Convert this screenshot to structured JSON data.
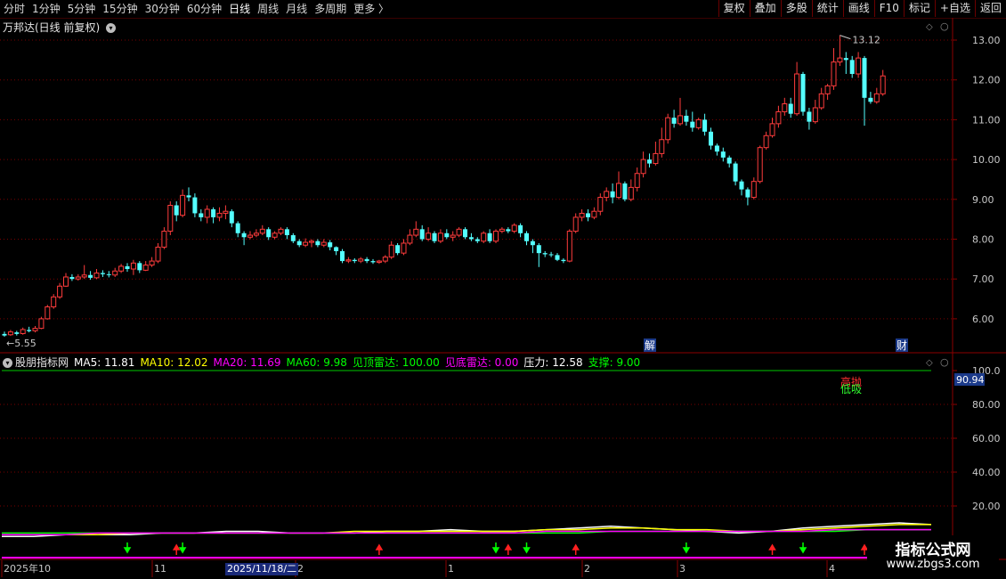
{
  "toolbar": {
    "periods": [
      "分时",
      "1分钟",
      "5分钟",
      "15分钟",
      "30分钟",
      "60分钟",
      "日线",
      "周线",
      "月线",
      "多周期",
      "更多 〉"
    ],
    "active_period": "日线",
    "right_buttons": [
      "复权",
      "叠加",
      "多股",
      "统计",
      "画线",
      "F10",
      "标记",
      "+自选",
      "返回"
    ]
  },
  "stock": {
    "title": "万邦达(日线 前复权)",
    "high_marker": "13.12",
    "low_marker": "5.55",
    "event_labels": [
      "解",
      "财"
    ]
  },
  "price_axis": {
    "ticks": [
      "13.00",
      "12.00",
      "11.00",
      "10.00",
      "9.00",
      "8.00",
      "7.00",
      "6.00"
    ]
  },
  "indicator": {
    "name": "股朋指标网",
    "ma5_label": "MA5: 11.81",
    "ma10_label": "MA10: 12.02",
    "ma20_label": "MA20: 11.69",
    "ma60_label": "MA60: 9.98",
    "top_radar_label": "见顶雷达: 100.00",
    "bottom_radar_label": "见底雷达: 0.00",
    "pressure_label": "压力: 12.58",
    "support_label": "支撑: 9.00",
    "tag_high": "高抛",
    "tag_low": "低吸",
    "current_value": "90.94",
    "axis_ticks": [
      "100.0",
      "80.00",
      "60.00",
      "40.00",
      "20.00"
    ]
  },
  "date_axis": {
    "labels": [
      "2025年10",
      "11",
      "2",
      "1",
      "2",
      "3",
      "4"
    ],
    "highlighted": "2025/11/18/二"
  },
  "watermark": {
    "title": "指标公式网",
    "url": "www.zbgs3.com"
  },
  "colors": {
    "up": "#ff3c3c",
    "down": "#54ffff",
    "ma5": "#ffffff",
    "ma10": "#ffff00",
    "ma20": "#ff00ff",
    "ma60": "#00ff00",
    "grid": "#7a0000"
  },
  "chart_data": {
    "type": "candlestick",
    "series": [
      {
        "name": "K线",
        "values": [
          [
            5.62,
            5.58,
            5.68,
            5.55
          ],
          [
            5.6,
            5.67,
            5.72,
            5.57
          ],
          [
            5.66,
            5.62,
            5.7,
            5.58
          ],
          [
            5.63,
            5.73,
            5.78,
            5.6
          ],
          [
            5.72,
            5.69,
            5.8,
            5.66
          ],
          [
            5.7,
            5.76,
            5.82,
            5.66
          ],
          [
            5.76,
            6.0,
            6.05,
            5.74
          ],
          [
            6.0,
            6.3,
            6.35,
            5.98
          ],
          [
            6.3,
            6.55,
            6.62,
            6.25
          ],
          [
            6.55,
            6.82,
            6.9,
            6.5
          ],
          [
            6.82,
            7.05,
            7.15,
            6.8
          ],
          [
            7.05,
            7.0,
            7.12,
            6.95
          ],
          [
            7.0,
            7.05,
            7.12,
            6.96
          ],
          [
            7.05,
            7.1,
            7.35,
            7.0
          ],
          [
            7.1,
            7.03,
            7.2,
            6.98
          ],
          [
            7.03,
            7.15,
            7.25,
            7.0
          ],
          [
            7.15,
            7.12,
            7.22,
            7.05
          ],
          [
            7.12,
            7.1,
            7.2,
            7.04
          ],
          [
            7.1,
            7.2,
            7.28,
            7.05
          ],
          [
            7.2,
            7.32,
            7.38,
            7.15
          ],
          [
            7.32,
            7.25,
            7.4,
            7.18
          ],
          [
            7.25,
            7.4,
            7.48,
            7.1
          ],
          [
            7.4,
            7.22,
            7.45,
            7.15
          ],
          [
            7.22,
            7.35,
            7.45,
            7.2
          ],
          [
            7.35,
            7.45,
            7.55,
            7.3
          ],
          [
            7.45,
            7.8,
            7.9,
            7.4
          ],
          [
            7.8,
            8.2,
            8.3,
            7.75
          ],
          [
            8.2,
            8.85,
            8.95,
            8.1
          ],
          [
            8.85,
            8.6,
            8.95,
            8.45
          ],
          [
            8.6,
            9.1,
            9.25,
            8.55
          ],
          [
            9.1,
            9.05,
            9.3,
            8.95
          ],
          [
            9.05,
            8.65,
            9.15,
            8.55
          ],
          [
            8.65,
            8.55,
            8.75,
            8.45
          ],
          [
            8.55,
            8.75,
            8.85,
            8.4
          ],
          [
            8.75,
            8.55,
            8.8,
            8.4
          ],
          [
            8.55,
            8.65,
            8.8,
            8.45
          ],
          [
            8.65,
            8.7,
            8.85,
            8.5
          ],
          [
            8.7,
            8.4,
            8.75,
            8.3
          ],
          [
            8.4,
            8.15,
            8.45,
            8.05
          ],
          [
            8.15,
            8.05,
            8.2,
            7.85
          ],
          [
            8.05,
            8.1,
            8.2,
            8.0
          ],
          [
            8.1,
            8.15,
            8.25,
            8.05
          ],
          [
            8.15,
            8.25,
            8.35,
            8.1
          ],
          [
            8.25,
            8.05,
            8.3,
            7.98
          ],
          [
            8.05,
            8.15,
            8.2,
            8.0
          ],
          [
            8.15,
            8.25,
            8.3,
            8.1
          ],
          [
            8.25,
            8.1,
            8.3,
            8.0
          ],
          [
            8.1,
            7.95,
            8.15,
            7.9
          ],
          [
            7.95,
            7.85,
            8.0,
            7.8
          ],
          [
            7.85,
            7.92,
            8.02,
            7.8
          ],
          [
            7.92,
            7.95,
            8.0,
            7.8
          ],
          [
            7.95,
            7.85,
            8.0,
            7.8
          ],
          [
            7.85,
            7.92,
            8.0,
            7.8
          ],
          [
            7.92,
            7.8,
            7.98,
            7.72
          ],
          [
            7.8,
            7.7,
            7.82,
            7.6
          ],
          [
            7.7,
            7.45,
            7.75,
            7.4
          ],
          [
            7.45,
            7.48,
            7.55,
            7.4
          ],
          [
            7.48,
            7.45,
            7.52,
            7.4
          ],
          [
            7.45,
            7.5,
            7.55,
            7.4
          ],
          [
            7.5,
            7.45,
            7.55,
            7.4
          ],
          [
            7.45,
            7.42,
            7.5,
            7.38
          ],
          [
            7.42,
            7.45,
            7.48,
            7.38
          ],
          [
            7.45,
            7.55,
            7.6,
            7.4
          ],
          [
            7.55,
            7.85,
            7.95,
            7.5
          ],
          [
            7.85,
            7.65,
            7.9,
            7.6
          ],
          [
            7.65,
            7.9,
            8.0,
            7.6
          ],
          [
            7.9,
            8.1,
            8.25,
            7.85
          ],
          [
            8.1,
            8.25,
            8.45,
            8.05
          ],
          [
            8.25,
            8.0,
            8.35,
            7.95
          ],
          [
            8.0,
            8.15,
            8.3,
            7.95
          ],
          [
            8.15,
            7.95,
            8.2,
            7.9
          ],
          [
            7.95,
            8.15,
            8.25,
            7.9
          ],
          [
            8.15,
            8.05,
            8.25,
            8.0
          ],
          [
            8.05,
            8.1,
            8.2,
            7.95
          ],
          [
            8.1,
            8.25,
            8.3,
            8.05
          ],
          [
            8.25,
            8.05,
            8.3,
            8.0
          ],
          [
            8.05,
            8.0,
            8.15,
            7.95
          ],
          [
            8.0,
            7.95,
            8.05,
            7.9
          ],
          [
            7.95,
            8.15,
            8.2,
            7.9
          ],
          [
            8.15,
            7.95,
            8.25,
            7.9
          ],
          [
            7.95,
            8.2,
            8.25,
            7.9
          ],
          [
            8.2,
            8.25,
            8.3,
            8.15
          ],
          [
            8.25,
            8.2,
            8.3,
            8.15
          ],
          [
            8.2,
            8.35,
            8.4,
            8.15
          ],
          [
            8.35,
            8.15,
            8.4,
            8.05
          ],
          [
            8.15,
            7.95,
            8.2,
            7.85
          ],
          [
            7.95,
            7.85,
            8.0,
            7.65
          ],
          [
            7.85,
            7.65,
            7.9,
            7.3
          ],
          [
            7.65,
            7.62,
            7.7,
            7.55
          ],
          [
            7.62,
            7.6,
            7.68,
            7.55
          ],
          [
            7.6,
            7.48,
            7.65,
            7.45
          ],
          [
            7.48,
            7.45,
            7.52,
            7.4
          ],
          [
            7.45,
            8.2,
            8.25,
            7.42
          ],
          [
            8.2,
            8.55,
            8.65,
            8.15
          ],
          [
            8.55,
            8.65,
            8.75,
            8.45
          ],
          [
            8.65,
            8.55,
            8.75,
            8.45
          ],
          [
            8.55,
            8.7,
            8.8,
            8.5
          ],
          [
            8.7,
            9.05,
            9.15,
            8.6
          ],
          [
            9.05,
            9.2,
            9.3,
            8.95
          ],
          [
            9.2,
            9.05,
            9.4,
            8.9
          ],
          [
            9.05,
            9.4,
            9.7,
            9.0
          ],
          [
            9.4,
            9.0,
            9.45,
            8.95
          ],
          [
            9.0,
            9.3,
            9.5,
            8.95
          ],
          [
            9.3,
            9.65,
            9.8,
            9.2
          ],
          [
            9.65,
            10.0,
            10.2,
            9.55
          ],
          [
            10.0,
            9.9,
            10.15,
            9.8
          ],
          [
            9.9,
            10.15,
            10.45,
            9.85
          ],
          [
            10.15,
            10.5,
            10.8,
            10.05
          ],
          [
            10.5,
            11.05,
            11.15,
            10.4
          ],
          [
            11.05,
            10.9,
            11.25,
            10.8
          ],
          [
            10.9,
            11.1,
            11.55,
            10.85
          ],
          [
            11.1,
            10.95,
            11.25,
            10.85
          ],
          [
            10.95,
            10.8,
            11.2,
            10.7
          ],
          [
            10.8,
            11.0,
            11.05,
            10.75
          ],
          [
            11.0,
            10.7,
            11.15,
            10.6
          ],
          [
            10.7,
            10.35,
            10.8,
            10.25
          ],
          [
            10.35,
            10.2,
            10.4,
            10.1
          ],
          [
            10.2,
            10.05,
            10.3,
            9.95
          ],
          [
            10.05,
            9.9,
            10.1,
            9.8
          ],
          [
            9.9,
            9.45,
            9.95,
            9.35
          ],
          [
            9.45,
            9.25,
            9.5,
            9.1
          ],
          [
            9.25,
            9.05,
            9.3,
            8.85
          ],
          [
            9.05,
            9.45,
            9.55,
            9.0
          ],
          [
            9.45,
            10.3,
            10.35,
            9.4
          ],
          [
            10.3,
            10.6,
            10.7,
            10.25
          ],
          [
            10.6,
            10.9,
            11.05,
            10.55
          ],
          [
            10.9,
            11.2,
            11.35,
            10.8
          ],
          [
            11.2,
            11.4,
            11.55,
            11.1
          ],
          [
            11.4,
            11.15,
            11.55,
            11.05
          ],
          [
            11.15,
            12.15,
            12.45,
            11.1
          ],
          [
            12.15,
            11.2,
            12.2,
            11.1
          ],
          [
            11.2,
            10.95,
            11.3,
            10.75
          ],
          [
            10.95,
            11.3,
            11.5,
            10.9
          ],
          [
            11.3,
            11.65,
            11.8,
            11.25
          ],
          [
            11.65,
            11.85,
            11.9,
            11.5
          ],
          [
            11.85,
            12.45,
            12.8,
            11.75
          ],
          [
            12.45,
            12.55,
            13.12,
            12.35
          ],
          [
            12.55,
            12.5,
            12.7,
            12.15
          ],
          [
            12.5,
            12.15,
            12.6,
            12.05
          ],
          [
            12.15,
            12.55,
            12.7,
            12.05
          ],
          [
            12.55,
            11.55,
            12.6,
            10.85
          ],
          [
            11.55,
            11.45,
            11.7,
            11.4
          ],
          [
            11.45,
            11.65,
            11.8,
            11.4
          ],
          [
            11.65,
            12.1,
            12.25,
            11.6
          ]
        ]
      }
    ],
    "ylim": [
      5.5,
      13.3
    ],
    "indicator_ylim": [
      0,
      105
    ],
    "indicator_lines": [
      {
        "name": "ma5",
        "values": [
          2,
          2,
          3,
          3,
          3,
          4,
          4,
          5,
          5,
          4,
          4,
          4,
          5,
          5,
          6,
          5,
          5,
          6,
          7,
          8,
          7,
          6,
          5,
          4,
          5,
          7,
          8,
          9,
          10,
          9
        ]
      },
      {
        "name": "ma10",
        "values": [
          3,
          3,
          3,
          3,
          4,
          4,
          4,
          4,
          4,
          4,
          4,
          5,
          5,
          5,
          5,
          5,
          5,
          6,
          6,
          7,
          7,
          6,
          6,
          5,
          5,
          6,
          7,
          8,
          9,
          9
        ]
      },
      {
        "name": "ma60",
        "values": [
          4,
          4,
          4,
          4,
          4,
          4,
          4,
          4,
          4,
          4,
          4,
          4,
          4,
          4,
          4,
          4,
          4,
          4,
          4,
          5,
          5,
          5,
          5,
          5,
          5,
          5,
          5,
          6,
          6,
          6
        ]
      },
      {
        "name": "ma20",
        "values": [
          3,
          3,
          3,
          4,
          4,
          4,
          4,
          4,
          4,
          4,
          4,
          4,
          4,
          4,
          4,
          4,
          4,
          5,
          5,
          5,
          5,
          5,
          5,
          5,
          5,
          5,
          6,
          6,
          6,
          6
        ]
      }
    ],
    "signals": [
      {
        "day": 20,
        "type": "buy"
      },
      {
        "day": 28,
        "type": "sell"
      },
      {
        "day": 29,
        "type": "buy"
      },
      {
        "day": 61,
        "type": "sell"
      },
      {
        "day": 80,
        "type": "buy"
      },
      {
        "day": 82,
        "type": "sell"
      },
      {
        "day": 85,
        "type": "buy"
      },
      {
        "day": 93,
        "type": "sell"
      },
      {
        "day": 111,
        "type": "buy"
      },
      {
        "day": 125,
        "type": "sell"
      },
      {
        "day": 130,
        "type": "buy"
      },
      {
        "day": 140,
        "type": "sell"
      }
    ]
  }
}
